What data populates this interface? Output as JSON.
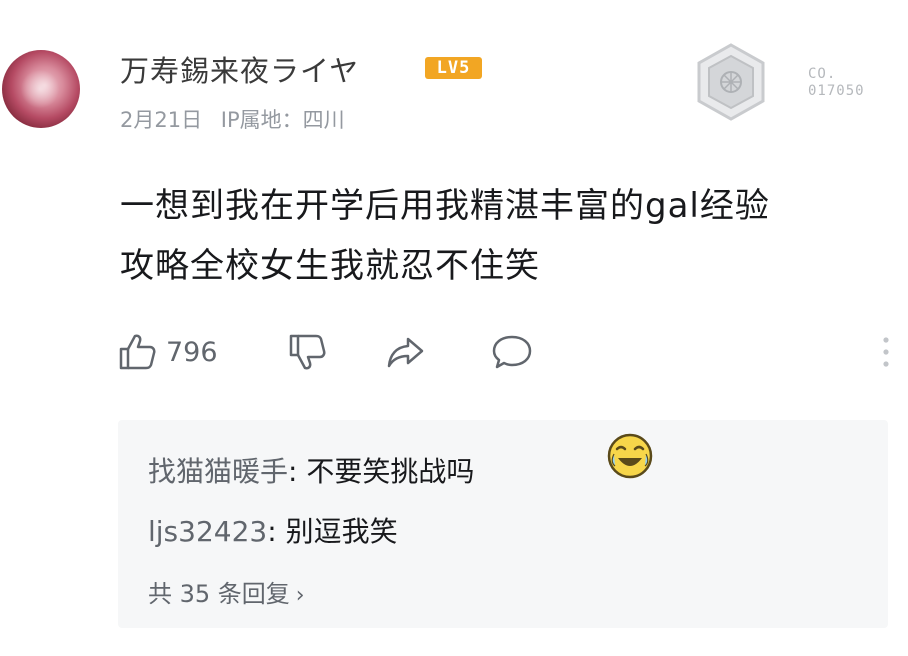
{
  "comment": {
    "username": "万寿錫来夜ライヤ",
    "level_badge": "LV5",
    "date": "2月21日",
    "ip_location": "IP属地：四川",
    "badge_text_line1": "CO.",
    "badge_text_line2": "017050",
    "content_line1": "一想到我在开学后用我精湛丰富的gal经验",
    "content_line2": "攻略全校女生我就忍不住笑",
    "like_count": "796",
    "icons": {
      "like": "thumbs-up-icon",
      "dislike": "thumbs-down-icon",
      "share": "share-icon",
      "reply": "comment-icon",
      "more": "more-vertical-icon"
    }
  },
  "replies": {
    "items": [
      {
        "name": "找猫猫暖手",
        "text": "不要笑挑战吗"
      },
      {
        "name": "ljs32423",
        "text": "别逗我笑"
      }
    ],
    "total": "共 35 条回复",
    "arrow": "›"
  },
  "colors": {
    "level_badge": "#f2a623",
    "secondary_text": "#9499a0",
    "reply_bg": "#f6f7f8"
  }
}
